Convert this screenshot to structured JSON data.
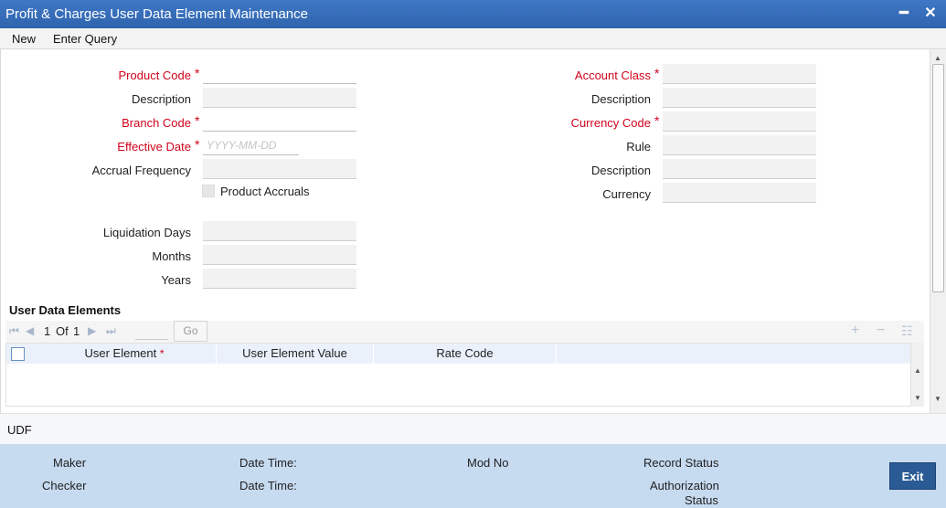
{
  "window": {
    "title": "Profit & Charges User Data Element Maintenance",
    "minimize": "━",
    "close": "✕"
  },
  "menu": {
    "new_label": "New",
    "enter_query_label": "Enter Query"
  },
  "left": {
    "product_code": {
      "label": "Product Code",
      "required": "*",
      "value": ""
    },
    "description1": {
      "label": "Description",
      "value": ""
    },
    "branch_code": {
      "label": "Branch Code",
      "required": "*",
      "value": ""
    },
    "effective_date": {
      "label": "Effective Date",
      "required": "*",
      "placeholder": "YYYY-MM-DD"
    },
    "accrual_frequency": {
      "label": "Accrual Frequency",
      "value": ""
    },
    "product_accruals": {
      "label": "Product Accruals",
      "checked": false
    },
    "liquidation_days": {
      "label": "Liquidation Days",
      "value": ""
    },
    "months": {
      "label": "Months",
      "value": ""
    },
    "years": {
      "label": "Years",
      "value": ""
    }
  },
  "right": {
    "account_class": {
      "label": "Account Class",
      "required": "*",
      "value": ""
    },
    "description2": {
      "label": "Description",
      "value": ""
    },
    "currency_code": {
      "label": "Currency Code",
      "required": "*",
      "value": ""
    },
    "rule": {
      "label": "Rule",
      "value": ""
    },
    "description3": {
      "label": "Description",
      "value": ""
    },
    "currency": {
      "label": "Currency",
      "value": ""
    }
  },
  "user_data": {
    "section_title": "User Data Elements",
    "page_current": "1",
    "page_of": "Of",
    "page_total": "1",
    "go_label": "Go",
    "columns": {
      "user_element": "User Element",
      "user_element_required": "*",
      "user_element_value": "User Element Value",
      "rate_code": "Rate Code"
    },
    "rows": []
  },
  "udf_label": "UDF",
  "footer": {
    "maker": "Maker",
    "checker": "Checker",
    "date_time_1": "Date Time:",
    "date_time_2": "Date Time:",
    "mod_no": "Mod No",
    "record_status": "Record Status",
    "authorization_status_line1": "Authorization",
    "authorization_status_line2": "Status",
    "exit_label": "Exit"
  },
  "colors": {
    "titlebar": "#2f63ad",
    "required": "#d0021b",
    "footer": "#c6daf0",
    "exit_button": "#2a5b95"
  }
}
